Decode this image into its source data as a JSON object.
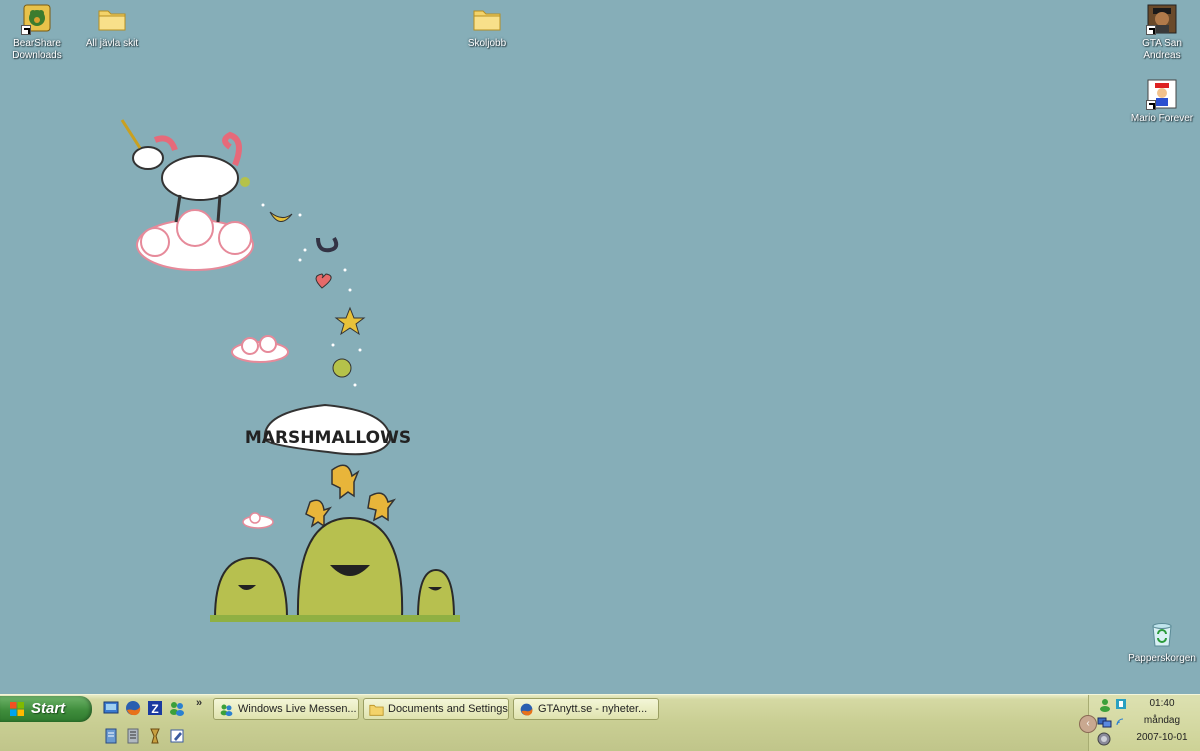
{
  "desktop": {
    "icons": [
      {
        "label": "BearShare\nDownloads",
        "icon": "bearshare-icon"
      },
      {
        "label": "All jävla skit",
        "icon": "folder-icon"
      },
      {
        "label": "Skoljobb",
        "icon": "folder-icon"
      },
      {
        "label": "GTA San\nAndreas",
        "icon": "gta-icon"
      },
      {
        "label": "Mario Forever",
        "icon": "mario-icon"
      },
      {
        "label": "Papperskorgen",
        "icon": "recycle-bin-icon"
      }
    ],
    "wallpaper": {
      "banner_text": "MARSHMALLOWS"
    }
  },
  "taskbar": {
    "start_label": "Start",
    "quick_launch": [
      "desktop-icon",
      "firefox-icon",
      "zone-icon",
      "messenger-icon",
      "notepad-icon",
      "winamp-icon",
      "tool-icon",
      "edit-icon"
    ],
    "more": "»",
    "tasks": [
      {
        "label": "Windows Live Messen...",
        "icon": "messenger-icon"
      },
      {
        "label": "Documents and Settings",
        "icon": "folder-icon"
      },
      {
        "label": "GTAnytt.se - nyheter...",
        "icon": "firefox-icon"
      }
    ],
    "tray": {
      "time": "01:40",
      "day": "måndag",
      "date": "2007-10-01",
      "toggle": "‹"
    }
  },
  "colors": {
    "desktop_bg": "#86aeb8",
    "taskbar": "#c9ce93",
    "start": "#3f8d3c"
  }
}
